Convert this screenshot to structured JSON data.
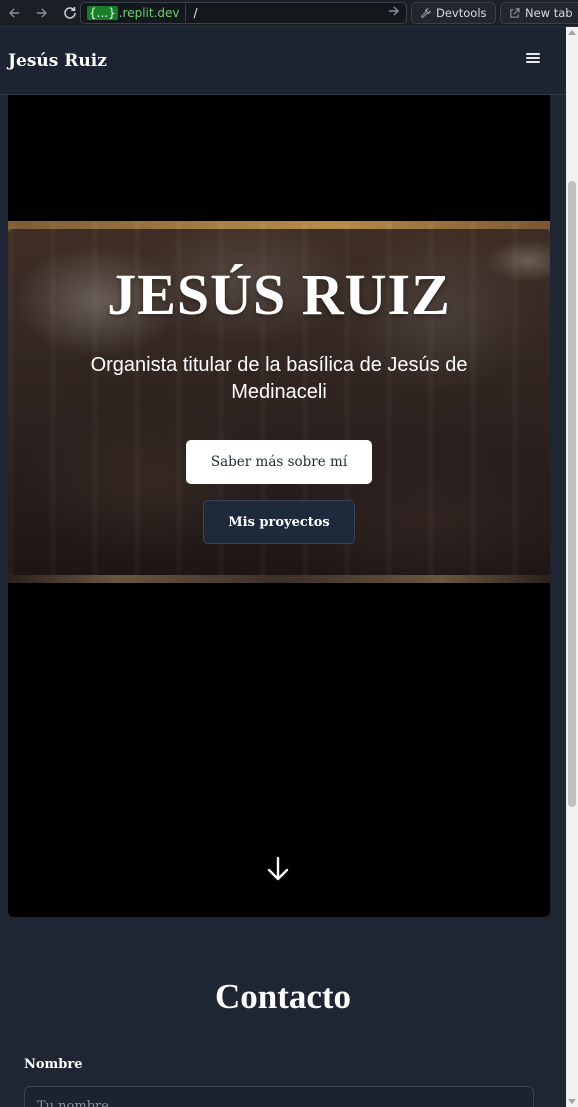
{
  "browser": {
    "url_domain_badge": "{...}",
    "url_domain": ".replit.dev",
    "url_path": "/",
    "devtools_label": "Devtools",
    "newtab_label": "New tab"
  },
  "header": {
    "brand": "Jesús Ruiz"
  },
  "hero": {
    "title": "JESÚS RUIZ",
    "subtitle": "Organista titular de la basílica de Jesús de Medinaceli",
    "primary_button": "Saber más sobre mí",
    "secondary_button": "Mis proyectos"
  },
  "contact": {
    "title": "Contacto",
    "name_label": "Nombre",
    "name_placeholder": "Tu nombre"
  },
  "icons": {
    "back": "arrow-left-icon",
    "forward": "arrow-right-icon",
    "reload": "reload-icon",
    "go": "arrow-right-icon",
    "devtools": "wrench-icon",
    "newtab": "external-link-icon",
    "menu": "hamburger-menu-icon",
    "scroll": "arrow-down-icon"
  }
}
